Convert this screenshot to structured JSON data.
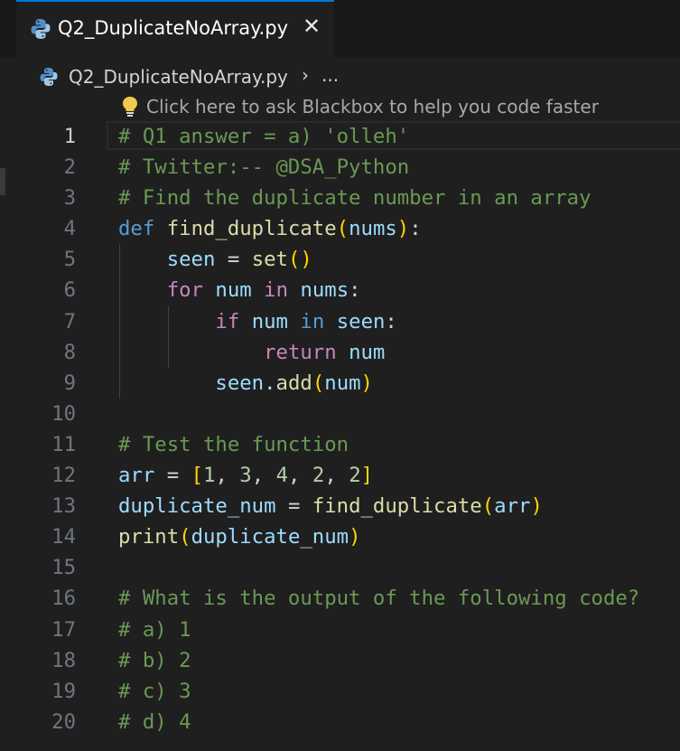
{
  "tab": {
    "title": "Q2_DuplicateNoArray.py",
    "close_glyph": "✕",
    "icon": "python-icon"
  },
  "breadcrumb": {
    "file": "Q2_DuplicateNoArray.py",
    "separator": "›",
    "more": "..."
  },
  "codelens": {
    "icon": "lightbulb-icon",
    "text": "Click here to ask Blackbox to help you code faster"
  },
  "editor": {
    "active_line": 1,
    "line_numbers": [
      "1",
      "2",
      "3",
      "4",
      "5",
      "6",
      "7",
      "8",
      "9",
      "10",
      "11",
      "12",
      "13",
      "14",
      "15",
      "16",
      "17",
      "18",
      "19",
      "20"
    ],
    "lines": [
      [
        {
          "t": "# Q1 answer = a) 'olleh'",
          "c": "cm"
        }
      ],
      [
        {
          "t": "# Twitter:-- @DSA_Python",
          "c": "cm"
        }
      ],
      [
        {
          "t": "# Find the duplicate number in an array",
          "c": "cm"
        }
      ],
      [
        {
          "t": "def",
          "c": "kw"
        },
        {
          "t": " ",
          "c": "op"
        },
        {
          "t": "find_duplicate",
          "c": "fn"
        },
        {
          "t": "(",
          "c": "p1"
        },
        {
          "t": "nums",
          "c": "vr"
        },
        {
          "t": ")",
          "c": "p1"
        },
        {
          "t": ":",
          "c": "op"
        }
      ],
      [
        {
          "t": "    ",
          "c": "op"
        },
        {
          "t": "seen",
          "c": "vr"
        },
        {
          "t": " = ",
          "c": "op"
        },
        {
          "t": "set",
          "c": "fn"
        },
        {
          "t": "()",
          "c": "p1"
        }
      ],
      [
        {
          "t": "    ",
          "c": "op"
        },
        {
          "t": "for",
          "c": "ct"
        },
        {
          "t": " ",
          "c": "op"
        },
        {
          "t": "num",
          "c": "vr"
        },
        {
          "t": " ",
          "c": "op"
        },
        {
          "t": "in",
          "c": "ct"
        },
        {
          "t": " ",
          "c": "op"
        },
        {
          "t": "nums",
          "c": "vr"
        },
        {
          "t": ":",
          "c": "op"
        }
      ],
      [
        {
          "t": "        ",
          "c": "op"
        },
        {
          "t": "if",
          "c": "ct"
        },
        {
          "t": " ",
          "c": "op"
        },
        {
          "t": "num",
          "c": "vr"
        },
        {
          "t": " ",
          "c": "op"
        },
        {
          "t": "in",
          "c": "kw"
        },
        {
          "t": " ",
          "c": "op"
        },
        {
          "t": "seen",
          "c": "vr"
        },
        {
          "t": ":",
          "c": "op"
        }
      ],
      [
        {
          "t": "            ",
          "c": "op"
        },
        {
          "t": "return",
          "c": "ct"
        },
        {
          "t": " ",
          "c": "op"
        },
        {
          "t": "num",
          "c": "vr"
        }
      ],
      [
        {
          "t": "        ",
          "c": "op"
        },
        {
          "t": "seen",
          "c": "vr"
        },
        {
          "t": ".",
          "c": "op"
        },
        {
          "t": "add",
          "c": "fn"
        },
        {
          "t": "(",
          "c": "p1"
        },
        {
          "t": "num",
          "c": "vr"
        },
        {
          "t": ")",
          "c": "p1"
        }
      ],
      [],
      [
        {
          "t": "# Test the function",
          "c": "cm"
        }
      ],
      [
        {
          "t": "arr",
          "c": "vr"
        },
        {
          "t": " = ",
          "c": "op"
        },
        {
          "t": "[",
          "c": "p1"
        },
        {
          "t": "1",
          "c": "nm"
        },
        {
          "t": ", ",
          "c": "op"
        },
        {
          "t": "3",
          "c": "nm"
        },
        {
          "t": ", ",
          "c": "op"
        },
        {
          "t": "4",
          "c": "nm"
        },
        {
          "t": ", ",
          "c": "op"
        },
        {
          "t": "2",
          "c": "nm"
        },
        {
          "t": ", ",
          "c": "op"
        },
        {
          "t": "2",
          "c": "nm"
        },
        {
          "t": "]",
          "c": "p1"
        }
      ],
      [
        {
          "t": "duplicate_num",
          "c": "vr"
        },
        {
          "t": " = ",
          "c": "op"
        },
        {
          "t": "find_duplicate",
          "c": "fn"
        },
        {
          "t": "(",
          "c": "p1"
        },
        {
          "t": "arr",
          "c": "vr"
        },
        {
          "t": ")",
          "c": "p1"
        }
      ],
      [
        {
          "t": "print",
          "c": "fn"
        },
        {
          "t": "(",
          "c": "p1"
        },
        {
          "t": "duplicate_num",
          "c": "vr"
        },
        {
          "t": ")",
          "c": "p1"
        }
      ],
      [],
      [
        {
          "t": "# What is the output of the following code?",
          "c": "cm"
        }
      ],
      [
        {
          "t": "# a) 1",
          "c": "cm"
        }
      ],
      [
        {
          "t": "# b) 2",
          "c": "cm"
        }
      ],
      [
        {
          "t": "# c) 3",
          "c": "cm"
        }
      ],
      [
        {
          "t": "# d) 4",
          "c": "cm"
        }
      ]
    ]
  },
  "colors": {
    "background": "#1f1f1f",
    "tab_border": "#0078d4",
    "comment": "#6a9955",
    "keyword": "#569cd6",
    "control": "#c586c0",
    "function": "#dcdcaa",
    "variable": "#9cdcfe",
    "number": "#b5cea8",
    "bracket": "#ffd700"
  }
}
